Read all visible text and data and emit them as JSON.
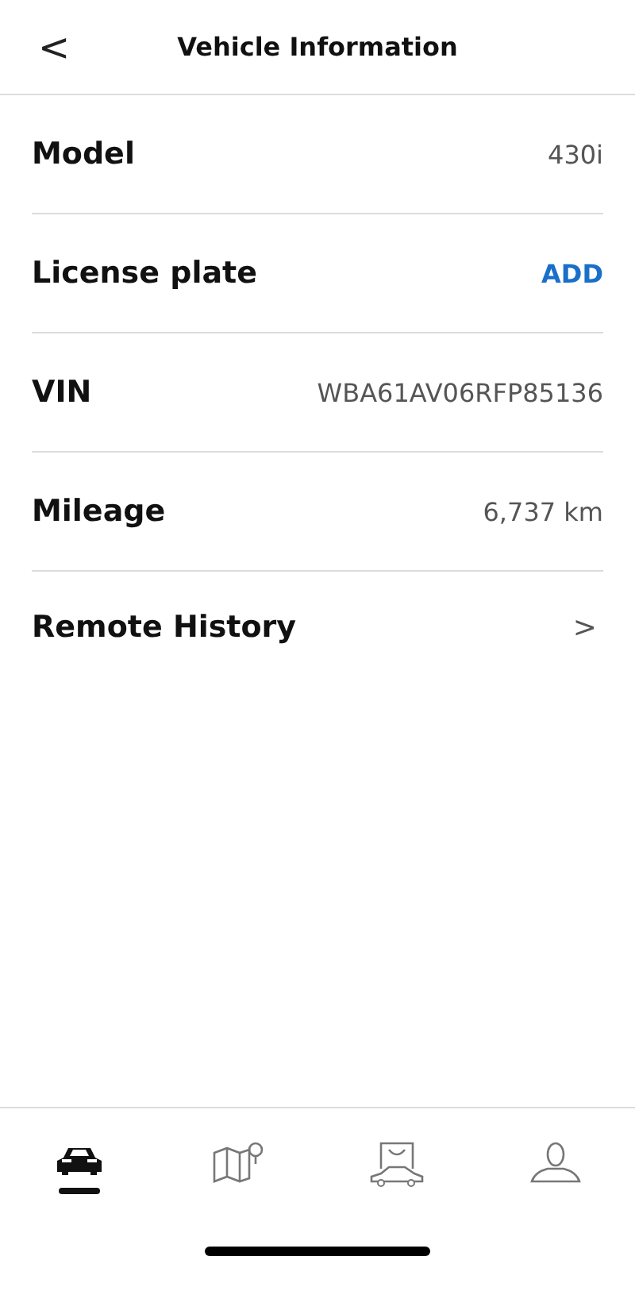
{
  "header": {
    "back": "<",
    "title": "Vehicle Information"
  },
  "rows": [
    {
      "kind": "value",
      "label": "Model",
      "value": "430i"
    },
    {
      "kind": "action",
      "label": "License plate",
      "value": "ADD"
    },
    {
      "kind": "value",
      "label": "VIN",
      "value": "WBA61AV06RFP85136"
    },
    {
      "kind": "value",
      "label": "Mileage",
      "value": "6,737 km"
    },
    {
      "kind": "link",
      "label": "Remote History",
      "value": ">"
    }
  ],
  "tab_bar": [
    {
      "kind": "car",
      "selected": true
    },
    {
      "kind": "map",
      "selected": false
    },
    {
      "kind": "shop",
      "selected": false
    },
    {
      "kind": "profile",
      "selected": false
    }
  ]
}
